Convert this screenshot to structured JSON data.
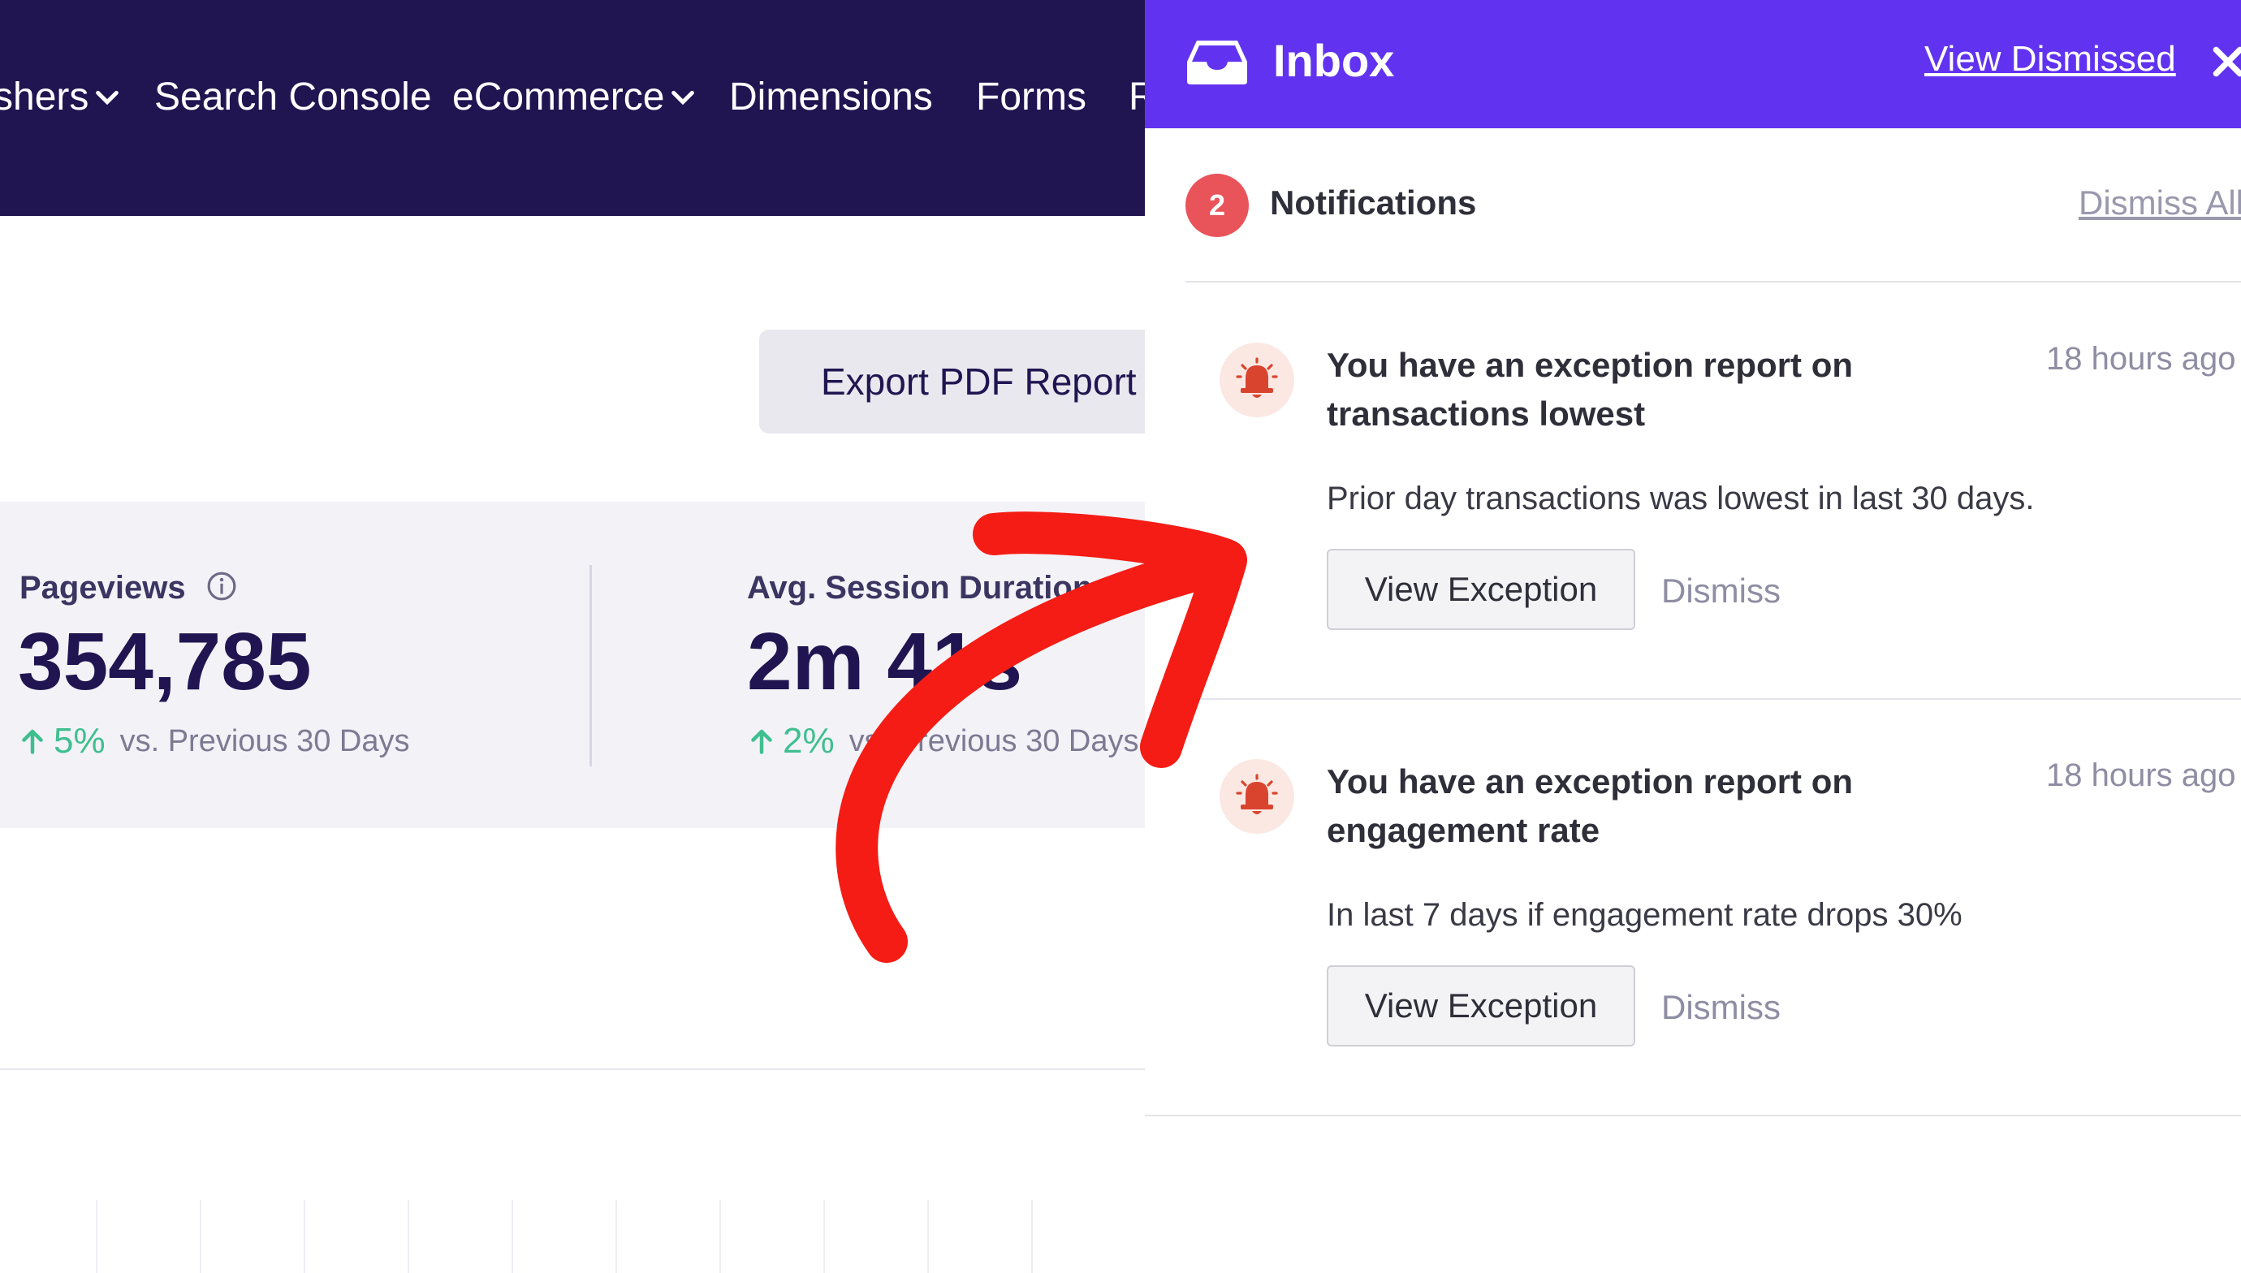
{
  "topnav": {
    "items": [
      {
        "label": "shers",
        "has_dropdown": true
      },
      {
        "label": "Search Console",
        "has_dropdown": false
      },
      {
        "label": "eCommerce",
        "has_dropdown": true
      },
      {
        "label": "Dimensions",
        "has_dropdown": false
      },
      {
        "label": "Forms",
        "has_dropdown": false
      },
      {
        "label": "R",
        "has_dropdown": false
      }
    ]
  },
  "toolbar": {
    "export_label": "Export PDF Report"
  },
  "stats": [
    {
      "label": "Pageviews",
      "value": "354,785",
      "change": "5%",
      "comparison": "vs. Previous 30 Days"
    },
    {
      "label": "Avg. Session Duration",
      "value": "2m 41s",
      "change": "2%",
      "comparison": "vs. Previous 30 Days"
    }
  ],
  "inbox": {
    "title": "Inbox",
    "view_dismissed": "View Dismissed",
    "notifications_label": "Notifications",
    "count": "2",
    "dismiss_all": "Dismiss All",
    "items": [
      {
        "title": "You have an exception report on transactions lowest",
        "time": "18 hours ago",
        "body": "Prior day transactions was lowest in last 30 days.",
        "view_label": "View Exception",
        "dismiss_label": "Dismiss"
      },
      {
        "title": "You have an exception report on engagement rate",
        "time": "18 hours ago",
        "body": "In last 7 days if engagement rate drops 30%",
        "view_label": "View Exception",
        "dismiss_label": "Dismiss"
      }
    ]
  },
  "colors": {
    "nav_bg": "#211551",
    "inbox_header": "#6133f0",
    "badge": "#e9545b",
    "positive": "#3fbf8f",
    "annotation_arrow": "#f41c14"
  }
}
